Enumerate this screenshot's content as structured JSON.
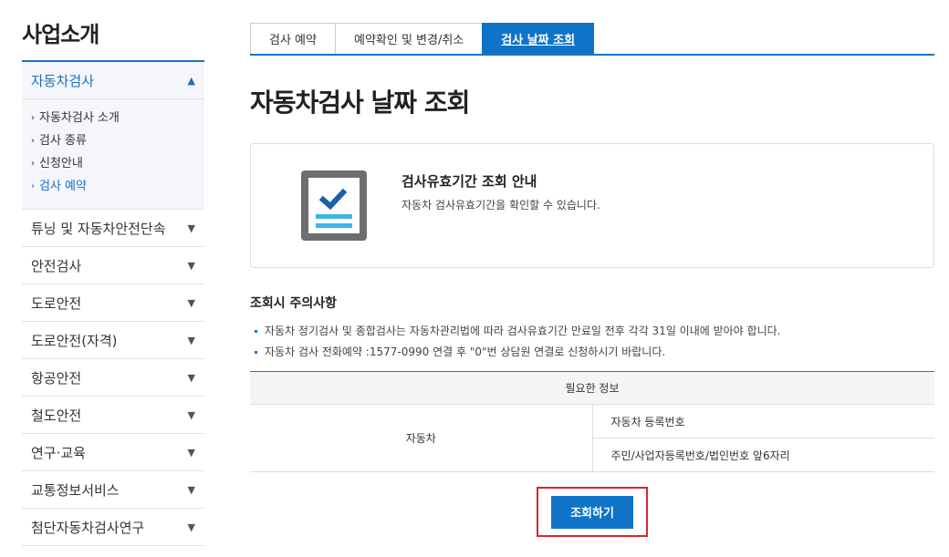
{
  "sidebar": {
    "title": "사업소개",
    "menu": [
      {
        "label": "자동차검사"
      },
      {
        "label": "튜닝 및 자동차안전단속"
      },
      {
        "label": "안전검사"
      },
      {
        "label": "도로안전"
      },
      {
        "label": "도로안전(자격)"
      },
      {
        "label": "항공안전"
      },
      {
        "label": "철도안전"
      },
      {
        "label": "연구·교육"
      },
      {
        "label": "교통정보서비스"
      },
      {
        "label": "첨단자동차검사연구"
      }
    ],
    "submenu": [
      {
        "label": "자동차검사 소개"
      },
      {
        "label": "검사 종류"
      },
      {
        "label": "신청안내"
      },
      {
        "label": "검사 예약"
      }
    ]
  },
  "tabs": [
    {
      "label": "검사 예약"
    },
    {
      "label": "예약확인 및 변경/취소"
    },
    {
      "label": "검사 날짜 조회"
    }
  ],
  "page_title": "자동차검사 날짜 조회",
  "info": {
    "title": "검사유효기간 조회 안내",
    "desc": "자동차 검사유효기간을 확인할 수 있습니다.",
    "icon": "checklist-document-icon"
  },
  "notice": {
    "title": "조회시 주의사항",
    "items": [
      "자동차 정기검사 및 종합검사는 자동차관리법에 따라 검사유효기간 만료일 전후 각각 31일 이내에 받아야 합니다.",
      "자동차 검사 전화예약 :1577-0990 연결 후 \"0\"번 상담원 연결로 신청하시기 바랍니다."
    ]
  },
  "table": {
    "header": "필요한 정보",
    "category": "자동차",
    "rows": [
      "자동차 등록번호",
      "주민/사업자등록번호/법인번호 앞6자리"
    ]
  },
  "button": {
    "label": "조회하기"
  },
  "colors": {
    "accent": "#0f74c8",
    "highlight_border": "#d9262b"
  }
}
